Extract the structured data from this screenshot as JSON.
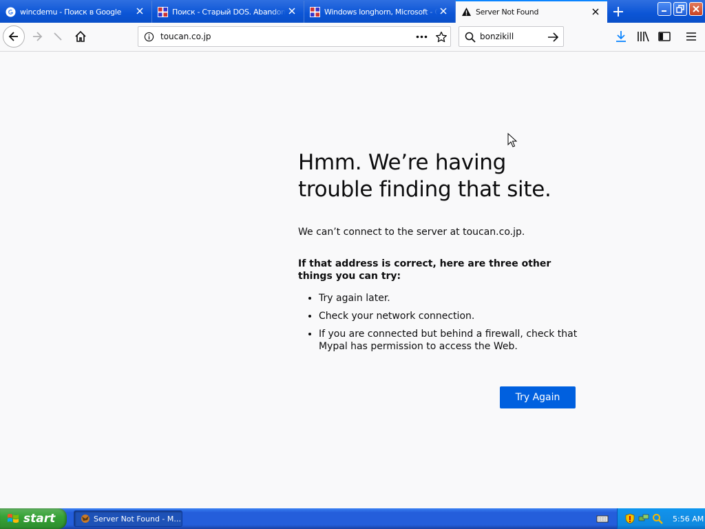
{
  "tabs": [
    {
      "title": "wincdemu - Поиск в Google",
      "icon": "google-icon",
      "active": false
    },
    {
      "title": "Поиск - Старый DOS. Abandonware",
      "icon": "olddos-icon",
      "active": false
    },
    {
      "title": "Windows longhorn, Microsoft - Cy",
      "icon": "olddos-icon",
      "active": false
    },
    {
      "title": "Server Not Found",
      "icon": "warning-icon",
      "active": true
    }
  ],
  "navbar": {
    "url": "toucan.co.jp",
    "search_query": "bonzikill"
  },
  "error_page": {
    "title": "Hmm. We’re having trouble finding that site.",
    "description": "We can’t connect to the server at toucan.co.jp.",
    "tips_title": "If that address is correct, here are three other things you can try:",
    "tips": [
      "Try again later.",
      "Check your network connection.",
      "If you are connected but behind a firewall, check that Mypal has permission to access the Web."
    ],
    "button_label": "Try Again"
  },
  "taskbar": {
    "start_label": "start",
    "items": [
      {
        "label": "Server Not Found - M..."
      }
    ],
    "clock": "5:56 AM"
  },
  "colors": {
    "accent": "#0060df",
    "tab_active_border": "#0a84ff",
    "title_bar": "#0b55d6",
    "page_bg": "#f9f9fa"
  }
}
